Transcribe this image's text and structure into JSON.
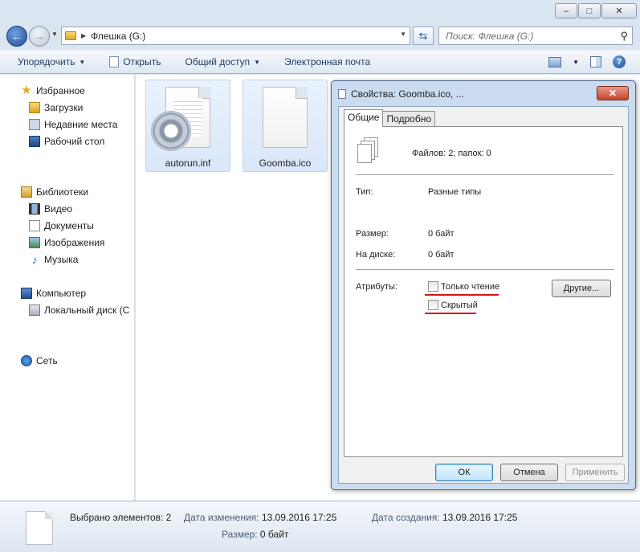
{
  "window": {
    "minimize": "–",
    "maximize": "□",
    "close": "✕"
  },
  "address_bar": {
    "path": "Флешка (G:)",
    "search_placeholder": "Поиск: Флешка (G:)"
  },
  "toolbar": {
    "organize": "Упорядочить",
    "open": "Открыть",
    "share": "Общий доступ",
    "email": "Электронная почта",
    "help": "?"
  },
  "nav": {
    "favorites": "Избранное",
    "downloads": "Загрузки",
    "recent": "Недавние места",
    "desktop": "Рабочий стол",
    "libraries": "Библиотеки",
    "video": "Видео",
    "documents": "Документы",
    "images": "Изображения",
    "music": "Музыка",
    "computer": "Компьютер",
    "local_disk": "Локальный диск (C",
    "network": "Сеть"
  },
  "files": [
    {
      "name": "autorun.inf"
    },
    {
      "name": "Goomba.ico"
    }
  ],
  "dialog": {
    "title": "Свойства: Goomba.ico, ...",
    "tab_general": "Общие",
    "tab_details": "Подробно",
    "summary": "Файлов: 2; папок: 0",
    "type_label": "Тип:",
    "type_value": "Разные типы",
    "size_label": "Размер:",
    "size_value": "0 байт",
    "ondisk_label": "На диске:",
    "ondisk_value": "0 байт",
    "attributes_label": "Атрибуты:",
    "readonly": "Только чтение",
    "hidden": "Скрытый",
    "other_button": "Другие...",
    "ok": "ОК",
    "cancel": "Отмена",
    "apply": "Применить"
  },
  "details_pane": {
    "selected": "Выбрано элементов: 2",
    "modified_label": "Дата изменения:",
    "modified_value": "13.09.2016 17:25",
    "created_label": "Дата создания:",
    "created_value": "13.09.2016 17:25",
    "size_label": "Размер:",
    "size_value": "0 байт"
  },
  "colors": {
    "frame": "#dbe5f1",
    "selection": "#d9e7f9",
    "annotation_red": "#e01010"
  }
}
